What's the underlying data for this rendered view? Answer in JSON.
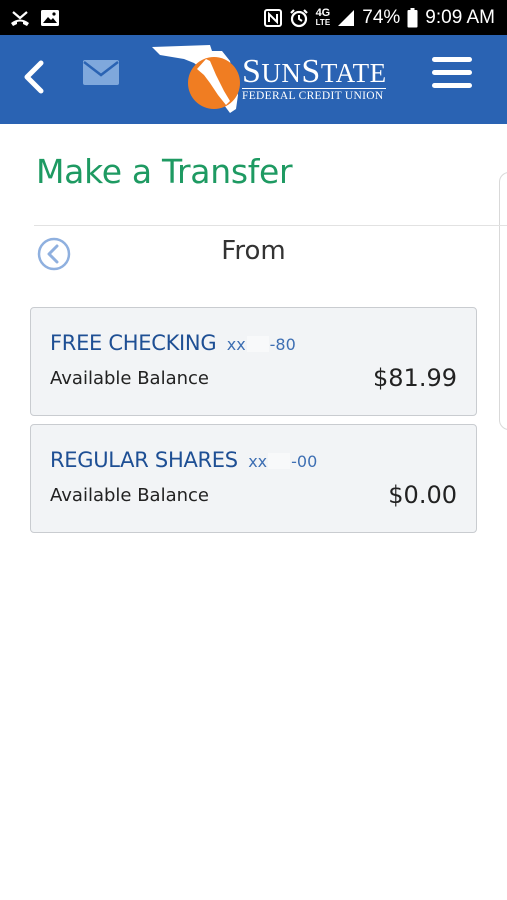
{
  "status_bar": {
    "battery": "74%",
    "time": "9:09 AM",
    "network": "4G",
    "network_sub": "LTE",
    "icons": [
      "missed-call-icon",
      "image-notification-icon",
      "nfc-icon",
      "alarm-icon",
      "signal-icon",
      "battery-icon"
    ]
  },
  "header": {
    "brand_name": "SunState",
    "brand_sub": "FEDERAL CREDIT UNION",
    "icons": [
      "back-chevron-icon",
      "mail-icon",
      "hamburger-menu-icon"
    ],
    "color": "#2a63b3"
  },
  "page": {
    "title": "Make a Transfer",
    "title_color": "#1e9a62",
    "section_title": "From"
  },
  "accounts": [
    {
      "name": "FREE CHECKING",
      "mask_prefix": "xx",
      "mask_suffix": "-80",
      "balance_label": "Available Balance",
      "balance": "$81.99"
    },
    {
      "name": "REGULAR SHARES",
      "mask_prefix": "xx",
      "mask_suffix": "-00",
      "balance_label": "Available Balance",
      "balance": "$0.00"
    }
  ]
}
